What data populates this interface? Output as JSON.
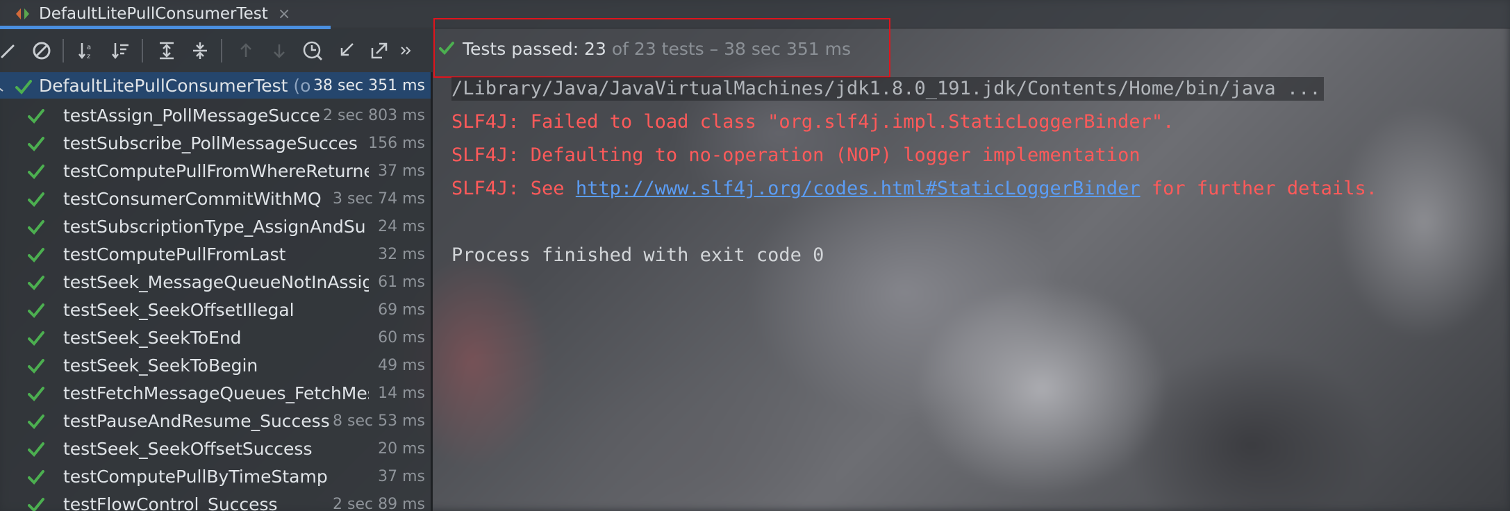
{
  "tab": {
    "title": "DefaultLitePullConsumerTest",
    "close_glyph": "×"
  },
  "toolbar": {
    "buttons": [
      {
        "name": "show-passed-icon"
      },
      {
        "name": "show-ignored-icon"
      },
      {
        "name": "sort-alphabetically-icon"
      },
      {
        "name": "sort-by-duration-icon"
      },
      {
        "name": "expand-all-icon"
      },
      {
        "name": "collapse-all-icon"
      },
      {
        "name": "previous-failed-icon"
      },
      {
        "name": "next-failed-icon"
      },
      {
        "name": "test-history-icon"
      },
      {
        "name": "import-tests-icon"
      },
      {
        "name": "export-results-icon"
      },
      {
        "name": "more-icon"
      }
    ]
  },
  "status": {
    "passed": "Tests passed: 23",
    "rest": "of 23 tests – 38 sec 351 ms"
  },
  "tree": {
    "root": {
      "name": "DefaultLitePullConsumerTest",
      "pkg": " (o",
      "time": "38 sec 351 ms"
    },
    "items": [
      {
        "name": "testAssign_PollMessageSucce",
        "time": "2 sec 803 ms"
      },
      {
        "name": "testSubscribe_PollMessageSucces",
        "time": "156 ms"
      },
      {
        "name": "testComputePullFromWhereReturne",
        "time": "37 ms"
      },
      {
        "name": "testConsumerCommitWithMQ",
        "time": "3 sec 74 ms"
      },
      {
        "name": "testSubscriptionType_AssignAndSu",
        "time": "24 ms"
      },
      {
        "name": "testComputePullFromLast",
        "time": "32 ms"
      },
      {
        "name": "testSeek_MessageQueueNotInAssig",
        "time": "61 ms"
      },
      {
        "name": "testSeek_SeekOffsetIllegal",
        "time": "69 ms"
      },
      {
        "name": "testSeek_SeekToEnd",
        "time": "60 ms"
      },
      {
        "name": "testSeek_SeekToBegin",
        "time": "49 ms"
      },
      {
        "name": "testFetchMessageQueues_FetchMes",
        "time": "14 ms"
      },
      {
        "name": "testPauseAndResume_Success",
        "time": "8 sec 53 ms"
      },
      {
        "name": "testSeek_SeekOffsetSuccess",
        "time": "20 ms"
      },
      {
        "name": "testComputePullByTimeStamp",
        "time": "37 ms"
      },
      {
        "name": "testFlowControl_Success",
        "time": "2 sec 89 ms"
      }
    ]
  },
  "console": {
    "cmd": "/Library/Java/JavaVirtualMachines/jdk1.8.0_191.jdk/Contents/Home/bin/java ...",
    "err1": "SLF4J: Failed to load class \"org.slf4j.impl.StaticLoggerBinder\".",
    "err2": "SLF4J: Defaulting to no-operation (NOP) logger implementation",
    "err3_prefix": "SLF4J: See ",
    "err3_link": "http://www.slf4j.org/codes.html#StaticLoggerBinder",
    "err3_suffix": " for further details.",
    "exit": "Process finished with exit code 0"
  },
  "colors": {
    "pass_green": "#4caf50",
    "error_red": "#ff5a5a",
    "link_blue": "#5b9df5",
    "selection": "#25466d",
    "highlight": "#e0141c"
  }
}
